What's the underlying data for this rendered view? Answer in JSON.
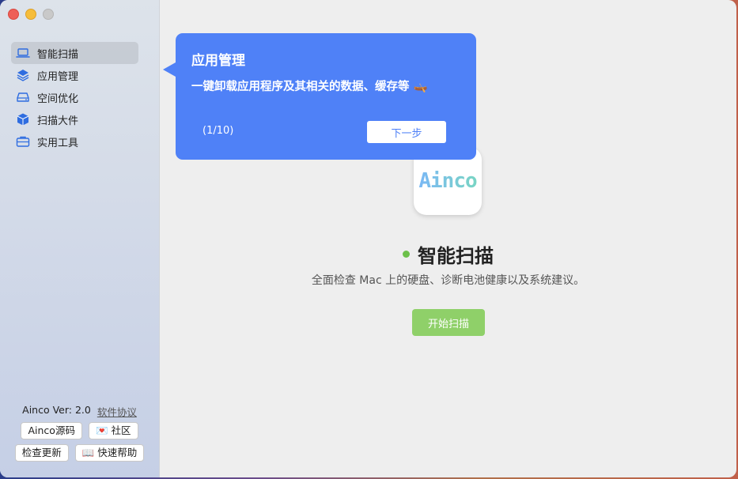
{
  "sidebar": {
    "items": [
      {
        "label": "智能扫描",
        "icon": "laptop-icon",
        "active": true
      },
      {
        "label": "应用管理",
        "icon": "layers-icon",
        "active": false
      },
      {
        "label": "空间优化",
        "icon": "drive-icon",
        "active": false
      },
      {
        "label": "扫描大件",
        "icon": "box-icon",
        "active": false
      },
      {
        "label": "实用工具",
        "icon": "toolbox-icon",
        "active": false
      }
    ],
    "version_label": "Ainco Ver: 2.0",
    "license_link": "软件协议",
    "source_button": "Ainco源码",
    "community_button": "💌 社区",
    "update_button": "检查更新",
    "help_button": "📖 快速帮助"
  },
  "main": {
    "logo_text": "Ainco",
    "title": "智能扫描",
    "description": "全面检查 Mac 上的硬盘、诊断电池健康以及系统建议。",
    "start_button": "开始扫描"
  },
  "tooltip": {
    "title": "应用管理",
    "body": "一键卸载应用程序及其相关的数据、缓存等 🛶",
    "counter": "(1/10)",
    "next_button": "下一步"
  },
  "colors": {
    "accent_blue": "#4f81f7",
    "start_green": "#8fd069",
    "status_green": "#6cc04a",
    "icon_blue": "#2f6de0"
  }
}
